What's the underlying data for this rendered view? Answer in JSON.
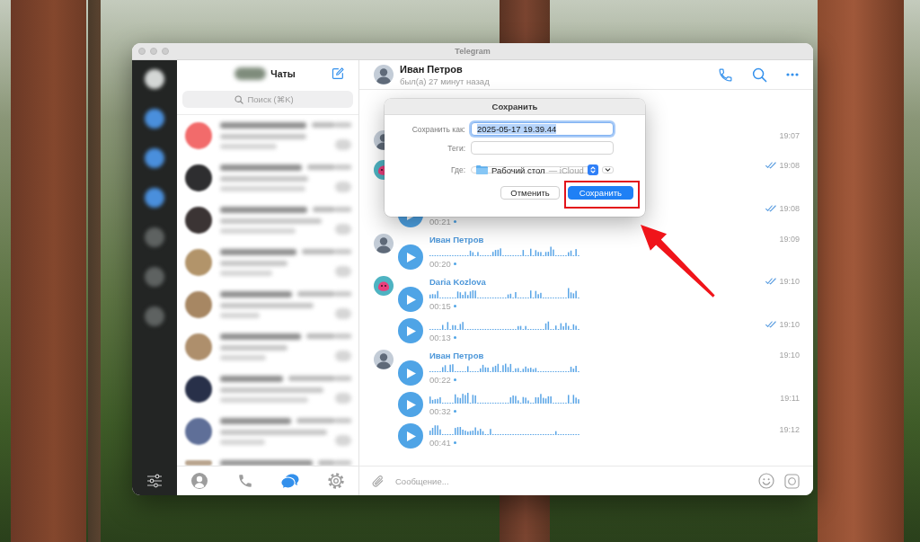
{
  "window": {
    "title": "Telegram"
  },
  "sidebar": {
    "folders": [
      {
        "color": "#d4d7d6"
      },
      {
        "color": "#4a8fdc"
      },
      {
        "color": "#4a8fdc"
      },
      {
        "color": "#4a8fdc"
      },
      {
        "color": "#5e6261"
      },
      {
        "color": "#5e6261"
      },
      {
        "color": "#5e6261"
      }
    ]
  },
  "chat_list": {
    "title": "Чаты",
    "search": {
      "placeholder": "Поиск (⌘K)"
    },
    "rows": [
      {
        "color": "#f26b6b"
      },
      {
        "color": "#2e2e30"
      },
      {
        "color": "#3b3434"
      },
      {
        "color": "#b2946a"
      },
      {
        "color": "#a78763"
      },
      {
        "color": "#ae8f6c"
      },
      {
        "color": "#283049"
      },
      {
        "color": "#5f6f98"
      },
      {
        "color": "#b9a58f"
      }
    ]
  },
  "tabs": [
    {
      "kind": "contacts",
      "selected": false
    },
    {
      "kind": "calls",
      "selected": false
    },
    {
      "kind": "chats",
      "selected": true
    },
    {
      "kind": "settings",
      "selected": false
    }
  ],
  "chat": {
    "name": "Иван Петров",
    "status": "был(а) 27 минут назад",
    "avatar": {
      "kind": "person"
    }
  },
  "groups": [
    {
      "avatar": {
        "kind": "person"
      },
      "messages": [
        {
          "kind": "hidden_text",
          "time": "19:07",
          "read_receipt": false
        }
      ]
    },
    {
      "avatar": {
        "kind": "blob"
      },
      "messages": [
        {
          "kind": "hidden_voice",
          "time": "19:08",
          "read_receipt": true
        },
        {
          "kind": "voice_partial",
          "time": "19:08",
          "read_receipt": true,
          "duration": "00:21",
          "unlistened": true
        }
      ]
    },
    {
      "avatar": {
        "kind": "person"
      },
      "name": "Иван Петров",
      "messages": [
        {
          "kind": "voice",
          "time": "19:09",
          "read_receipt": false,
          "duration": "00:20",
          "unlistened": true
        }
      ]
    },
    {
      "avatar": {
        "kind": "blob"
      },
      "name": "Daria Kozlova",
      "messages": [
        {
          "kind": "voice",
          "time": "19:10",
          "read_receipt": true,
          "duration": "00:15",
          "unlistened": true
        },
        {
          "kind": "voice",
          "time": "19:10",
          "read_receipt": true,
          "duration": "00:13",
          "unlistened": true
        }
      ]
    },
    {
      "avatar": {
        "kind": "person"
      },
      "name": "Иван Петров",
      "messages": [
        {
          "kind": "voice",
          "time": "19:10",
          "read_receipt": false,
          "duration": "00:22",
          "unlistened": true
        },
        {
          "kind": "voice",
          "time": "19:11",
          "read_receipt": false,
          "duration": "00:32",
          "unlistened": true
        },
        {
          "kind": "voice",
          "time": "19:12",
          "read_receipt": false,
          "duration": "00:41",
          "unlistened": true
        }
      ]
    }
  ],
  "composer": {
    "placeholder": "Сообщение..."
  },
  "dialog": {
    "title": "Сохранить",
    "fields": [
      {
        "label": "Сохранить как:",
        "value": "2025-05-17 19.39.44",
        "focused": true,
        "text_selected": true
      },
      {
        "label": "Теги:",
        "focused": false
      }
    ],
    "where": {
      "label": "Где:",
      "location": "Рабочий стол",
      "detail": "— iCloud",
      "expanded": false
    },
    "buttons": [
      {
        "label": "Отменить",
        "kind": "secondary",
        "highlighted": false
      },
      {
        "label": "Сохранить",
        "kind": "primary",
        "highlighted": true
      }
    ]
  },
  "pointer_arrow": true
}
